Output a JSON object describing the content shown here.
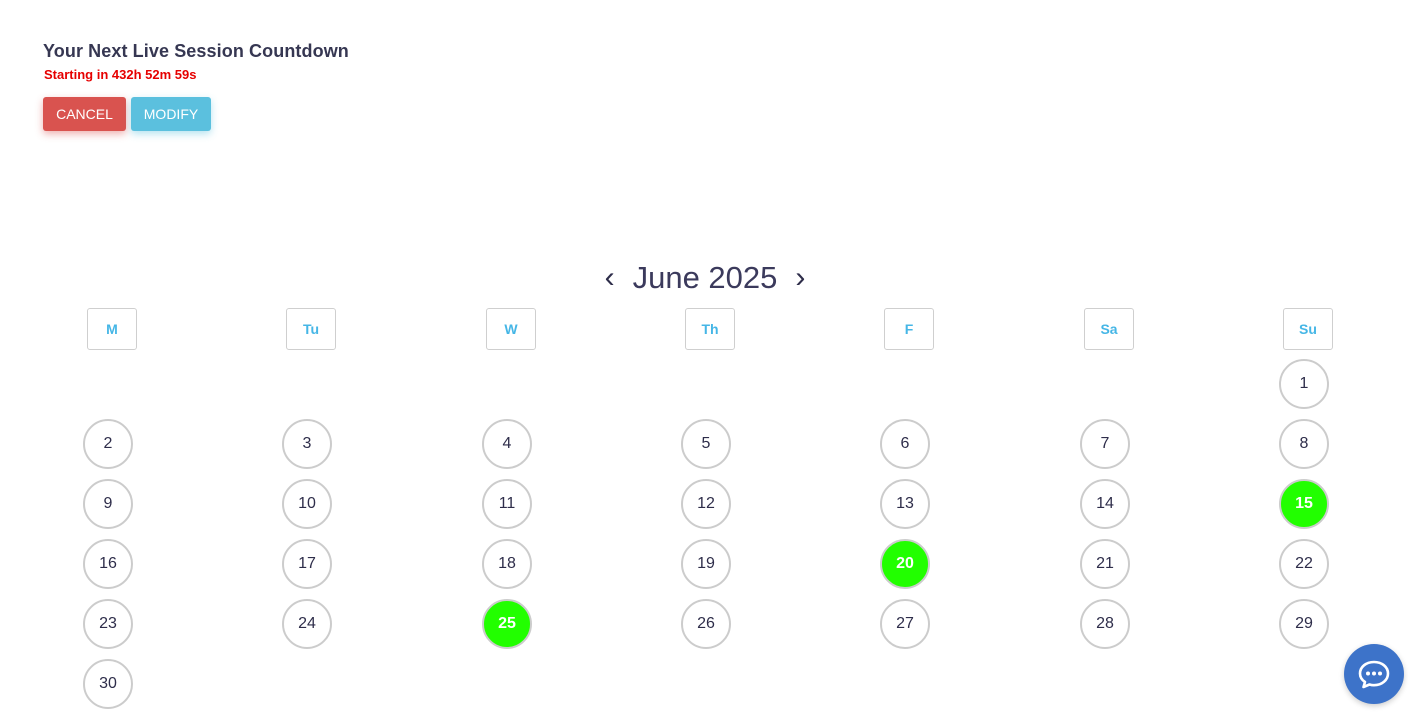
{
  "session": {
    "title": "Your Next Live Session Countdown",
    "countdown": "Starting in 432h 52m 59s",
    "cancel_label": "CANCEL",
    "modify_label": "MODIFY"
  },
  "calendar": {
    "month_label": "June 2025",
    "prev_icon": "‹",
    "next_icon": "›",
    "weekdays": [
      "M",
      "Tu",
      "W",
      "Th",
      "F",
      "Sa",
      "Su"
    ],
    "first_weekday_index": 6,
    "days_in_month": 30,
    "days": [
      "1",
      "2",
      "3",
      "4",
      "5",
      "6",
      "7",
      "8",
      "9",
      "10",
      "11",
      "12",
      "13",
      "14",
      "15",
      "16",
      "17",
      "18",
      "19",
      "20",
      "21",
      "22",
      "23",
      "24",
      "25",
      "26",
      "27",
      "28",
      "29",
      "30"
    ],
    "session_days": [
      15,
      20,
      25
    ],
    "session_color": "#22ff00"
  },
  "chat": {
    "icon": "chat-bubble-icon"
  },
  "colors": {
    "cancel": "#d9534f",
    "modify": "#5bc0de",
    "countdown": "#e60000",
    "weekday": "#45b6e6",
    "chat": "#3d73c9"
  }
}
